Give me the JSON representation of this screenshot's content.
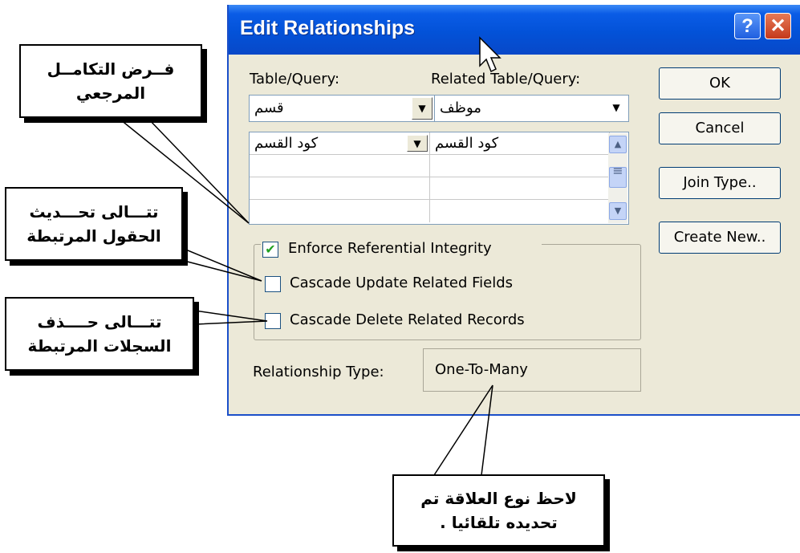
{
  "dialog": {
    "title": "Edit Relationships",
    "help_label": "?",
    "close_label": "✕",
    "table_query_label": "Table/Query:",
    "related_table_label": "Related Table/Query:",
    "table_value": "قسم",
    "related_table_value": "موظف",
    "grid_rows": [
      {
        "left": "كود القسم",
        "right": "كود القسم"
      },
      {
        "left": "",
        "right": ""
      },
      {
        "left": "",
        "right": ""
      },
      {
        "left": "",
        "right": ""
      }
    ],
    "buttons": {
      "ok": "OK",
      "cancel": "Cancel",
      "join_type": "Join Type..",
      "create_new": "Create New.."
    },
    "enforce_label": "Enforce Referential Integrity",
    "enforce_checked": true,
    "cascade_update_label": "Cascade Update Related Fields",
    "cascade_update_checked": false,
    "cascade_delete_label": "Cascade Delete Related Records",
    "cascade_delete_checked": false,
    "relationship_type_label": "Relationship Type:",
    "relationship_type_value": "One-To-Many"
  },
  "callouts": {
    "enforce": [
      "فــرض التكامــل",
      "المرجعي"
    ],
    "cascade_update": [
      "تتـــالى تحـــديث",
      "الحقول المرتبطة"
    ],
    "cascade_delete": [
      "تتـــالى حــــذف",
      "السجلات المرتبطة"
    ],
    "relationship_note": [
      "لاحظ نوع العلاقة تم",
      "تحديده تلقائيا ."
    ]
  }
}
